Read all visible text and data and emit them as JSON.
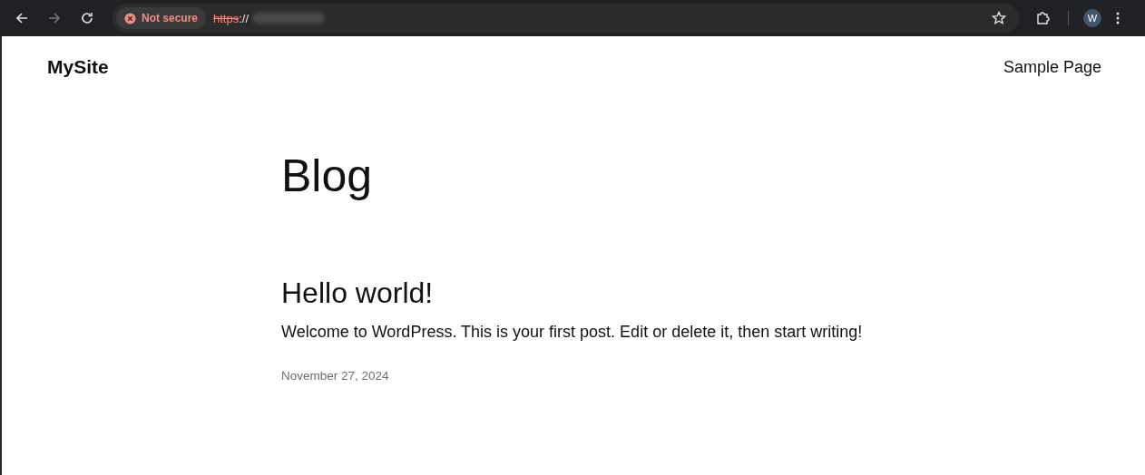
{
  "browser": {
    "security_chip": "Not secure",
    "url_scheme": "https",
    "url_rest": "://",
    "avatar_letter": "W"
  },
  "site": {
    "title": "MySite",
    "nav": [
      {
        "label": "Sample Page"
      }
    ]
  },
  "page": {
    "heading": "Blog",
    "posts": [
      {
        "title": "Hello world!",
        "excerpt": "Welcome to WordPress. This is your first post. Edit or delete it, then start writing!",
        "date": "November 27, 2024"
      }
    ]
  }
}
